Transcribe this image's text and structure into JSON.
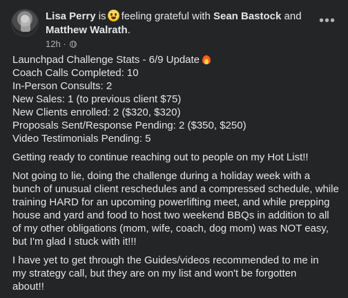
{
  "post": {
    "author": "Lisa Perry",
    "verb_is": "is",
    "feeling": "feeling grateful with",
    "tag1": "Sean Bastock",
    "and_word": "and",
    "tag2": "Matthew Walrath",
    "period": ".",
    "time": "12h",
    "dot": "·",
    "feeling_icon": "grateful-emoji",
    "audience_icon": "globe-icon",
    "more_label": "•••"
  },
  "body": {
    "stats_title": "Launchpad Challenge Stats - 6/9 Update",
    "stats_title_icon": "fire-emoji",
    "stats": [
      "Coach Calls Completed: 10",
      "In-Person Consults: 2",
      "New Sales: 1 (to previous client $75)",
      "New Clients enrolled: 2 ($320, $320)",
      "Proposals Sent/Response Pending: 2 ($350, $250)",
      "Video Testimonials Pending: 5"
    ],
    "p1": "Getting ready to continue reaching out to people on my Hot List!!",
    "p2_lines": [
      "Not going to lie, doing the challenge during a holiday week with a",
      "bunch of unusual client reschedules and a compressed schedule, while",
      "training HARD for an upcoming powerlifting meet, and while prepping",
      "house and yard and food to host two weekend BBQs in addition to all",
      "of my other obligations (mom, wife, coach, dog mom) was NOT easy,",
      "but I'm glad I stuck with it!!!"
    ],
    "p3_lines": [
      "I have yet to get through the Guides/videos recommended to me in",
      "my strategy call, but they are on my list and won't be forgotten",
      "about!!"
    ]
  }
}
